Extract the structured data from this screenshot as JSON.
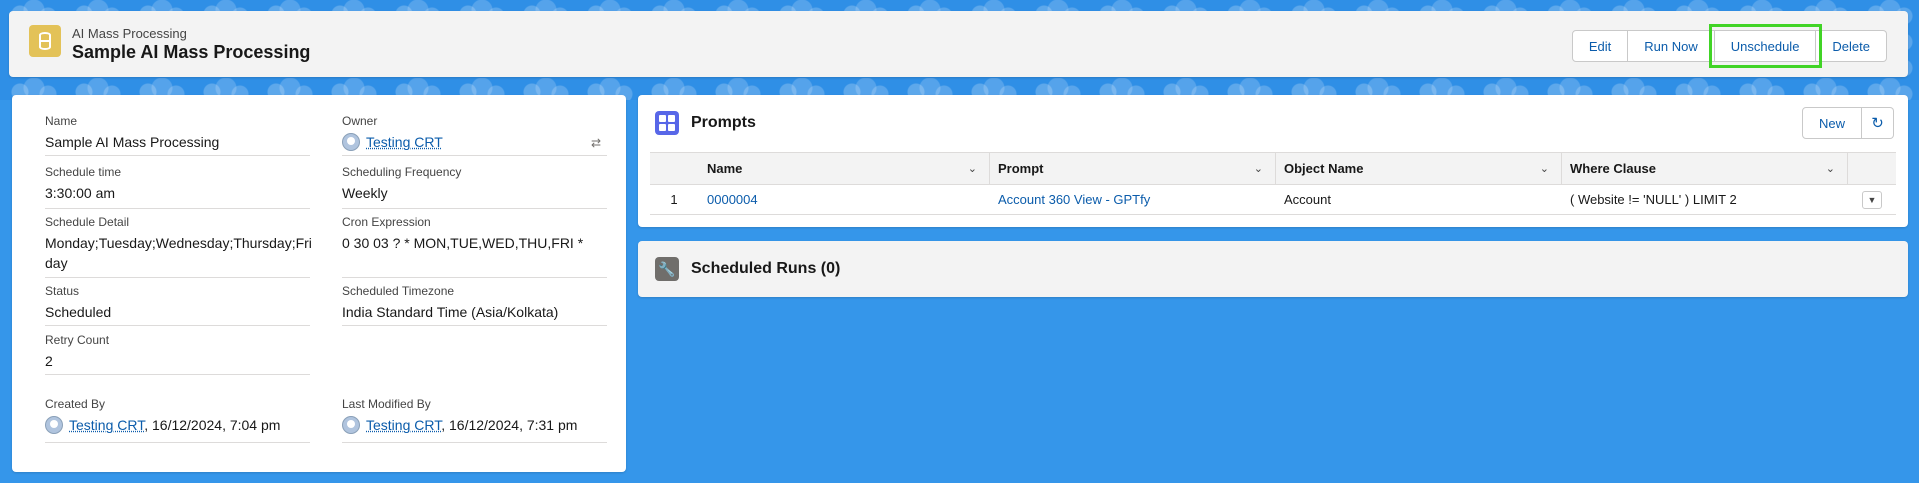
{
  "header": {
    "object_type": "AI Mass Processing",
    "record_title": "Sample AI Mass Processing",
    "object_icon": "database-icon",
    "buttons": {
      "edit": "Edit",
      "run_now": "Run Now",
      "unschedule": "Unschedule",
      "delete": "Delete"
    }
  },
  "details": {
    "name": {
      "label": "Name",
      "value": "Sample AI Mass Processing"
    },
    "owner": {
      "label": "Owner",
      "value": "Testing CRT"
    },
    "schedule_time": {
      "label": "Schedule time",
      "value": "3:30:00 am"
    },
    "scheduling_frequency": {
      "label": "Scheduling Frequency",
      "value": "Weekly"
    },
    "schedule_detail": {
      "label": "Schedule Detail",
      "line1": "Monday;Tuesday;Wednesday;Thursday;Fri",
      "line2": "day"
    },
    "cron_expression": {
      "label": "Cron Expression",
      "value": "0 30 03 ? * MON,TUE,WED,THU,FRI *"
    },
    "status": {
      "label": "Status",
      "value": "Scheduled"
    },
    "scheduled_timezone": {
      "label": "Scheduled Timezone",
      "value": "India Standard Time (Asia/Kolkata)"
    },
    "retry_count": {
      "label": "Retry Count",
      "value": "2"
    },
    "created_by": {
      "label": "Created By",
      "user": "Testing CRT",
      "date": ", 16/12/2024, 7:04 pm"
    },
    "last_modified_by": {
      "label": "Last Modified By",
      "user": "Testing CRT",
      "date": ", 16/12/2024, 7:31 pm"
    }
  },
  "prompts": {
    "title": "Prompts",
    "new_label": "New",
    "refresh_icon": "refresh-icon",
    "columns": [
      "Name",
      "Prompt",
      "Object Name",
      "Where Clause"
    ],
    "rows": [
      {
        "num": "1",
        "name": "0000004",
        "prompt": "Account 360 View - GPTfy",
        "object_name": "Account",
        "where_clause": "( Website != 'NULL' ) LIMIT 2"
      }
    ]
  },
  "scheduled_runs": {
    "title": "Scheduled Runs (0)",
    "icon": "wrench-icon"
  },
  "colors": {
    "background": "#3596ea",
    "accent_link": "#0b5cab",
    "highlight": "#41d426",
    "prompts_icon": "#5867e8",
    "runs_icon": "#706e6b",
    "object_icon": "#e3c258"
  }
}
